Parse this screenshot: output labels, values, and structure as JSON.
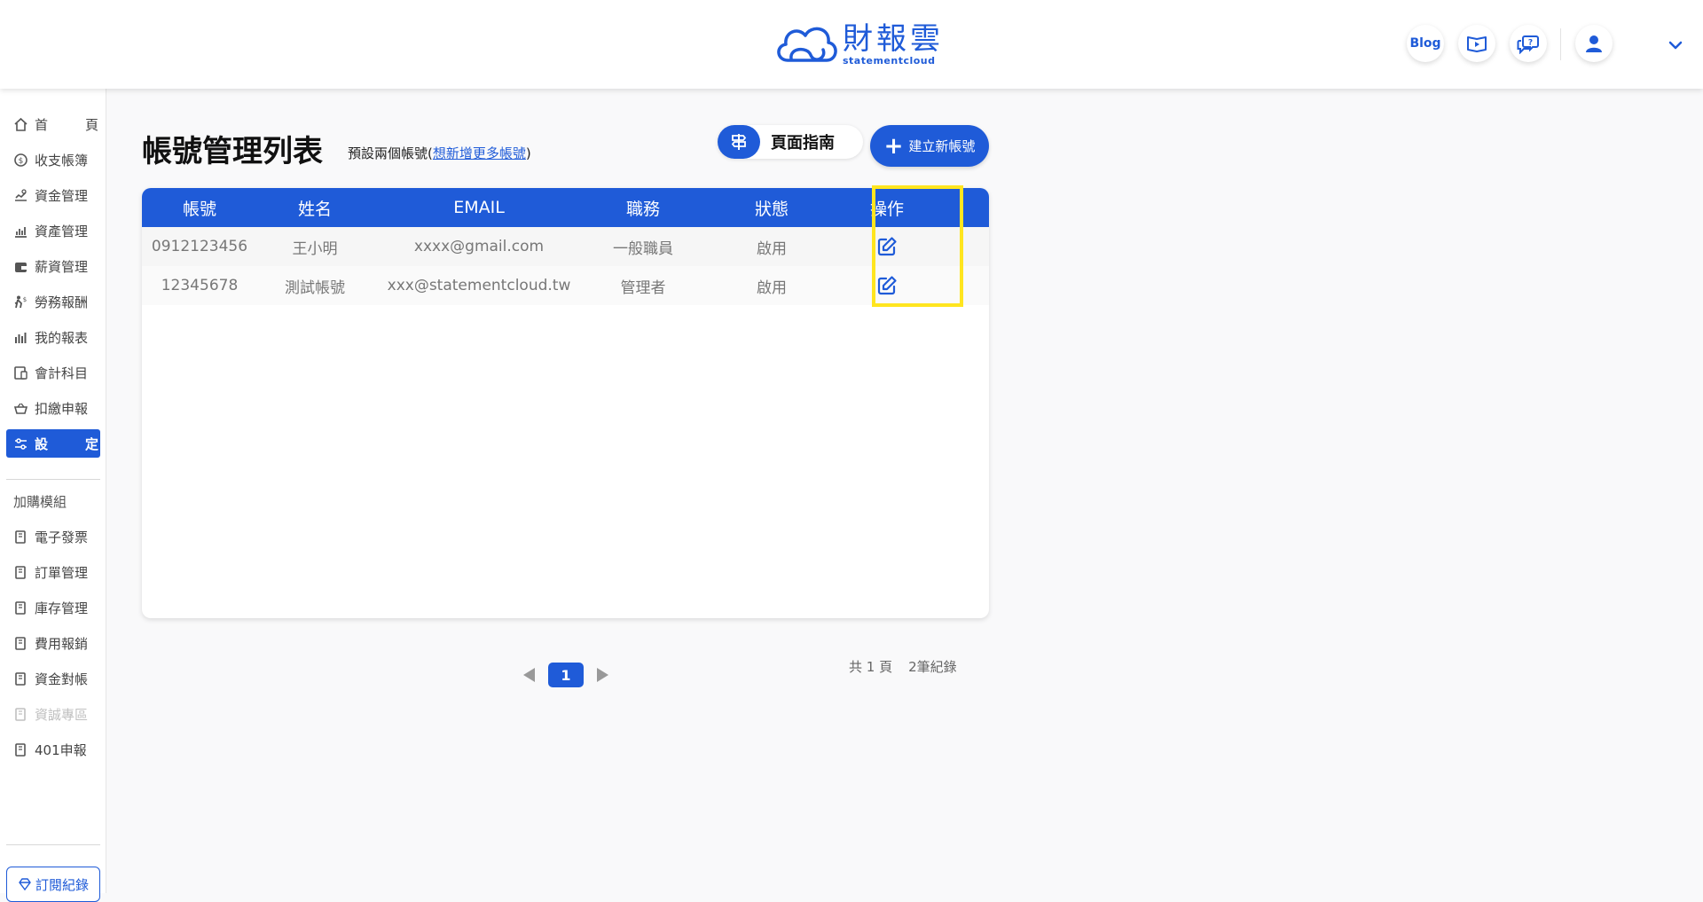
{
  "brand": {
    "name_cn": "財報雲",
    "name_en": "statementcloud"
  },
  "header": {
    "blog_label": "Blog"
  },
  "sidebar": {
    "items": [
      {
        "label": "首頁",
        "chars": [
          "首",
          "頁"
        ]
      },
      {
        "label": "收支帳簿"
      },
      {
        "label": "資金管理"
      },
      {
        "label": "資產管理"
      },
      {
        "label": "薪資管理"
      },
      {
        "label": "勞務報酬"
      },
      {
        "label": "我的報表"
      },
      {
        "label": "會計科目"
      },
      {
        "label": "扣繳申報"
      },
      {
        "label": "設定",
        "chars": [
          "設",
          "定"
        ],
        "active": true
      }
    ],
    "addon_section_label": "加購模組",
    "addons": [
      {
        "label": "電子發票"
      },
      {
        "label": "訂單管理"
      },
      {
        "label": "庫存管理"
      },
      {
        "label": "費用報銷"
      },
      {
        "label": "資金對帳"
      },
      {
        "label": "資誠專區",
        "disabled": true
      },
      {
        "label": "401申報"
      }
    ],
    "subscription_label": "訂閱紀錄"
  },
  "main": {
    "title": "帳號管理列表",
    "subtitle_prefix": "預設兩個帳號(",
    "subtitle_link": "想新增更多帳號",
    "subtitle_suffix": ")",
    "guide_label": "頁面指南",
    "create_label": "建立新帳號"
  },
  "table": {
    "columns": [
      "帳號",
      "姓名",
      "EMAIL",
      "職務",
      "狀態",
      "操作"
    ],
    "rows": [
      {
        "account": "0912123456",
        "name": "王小明",
        "email": "xxxx@gmail.com",
        "role": "一般職員",
        "status": "啟用"
      },
      {
        "account": "12345678",
        "name": "測試帳號",
        "email": "xxx@statementcloud.tw",
        "role": "管理者",
        "status": "啟用"
      }
    ]
  },
  "pagination": {
    "current_page": "1",
    "total_pages_text": "共 1 頁",
    "total_records_text": "2筆紀錄"
  },
  "colors": {
    "accent": "#1f5bd8",
    "highlight": "#ffe51f"
  }
}
